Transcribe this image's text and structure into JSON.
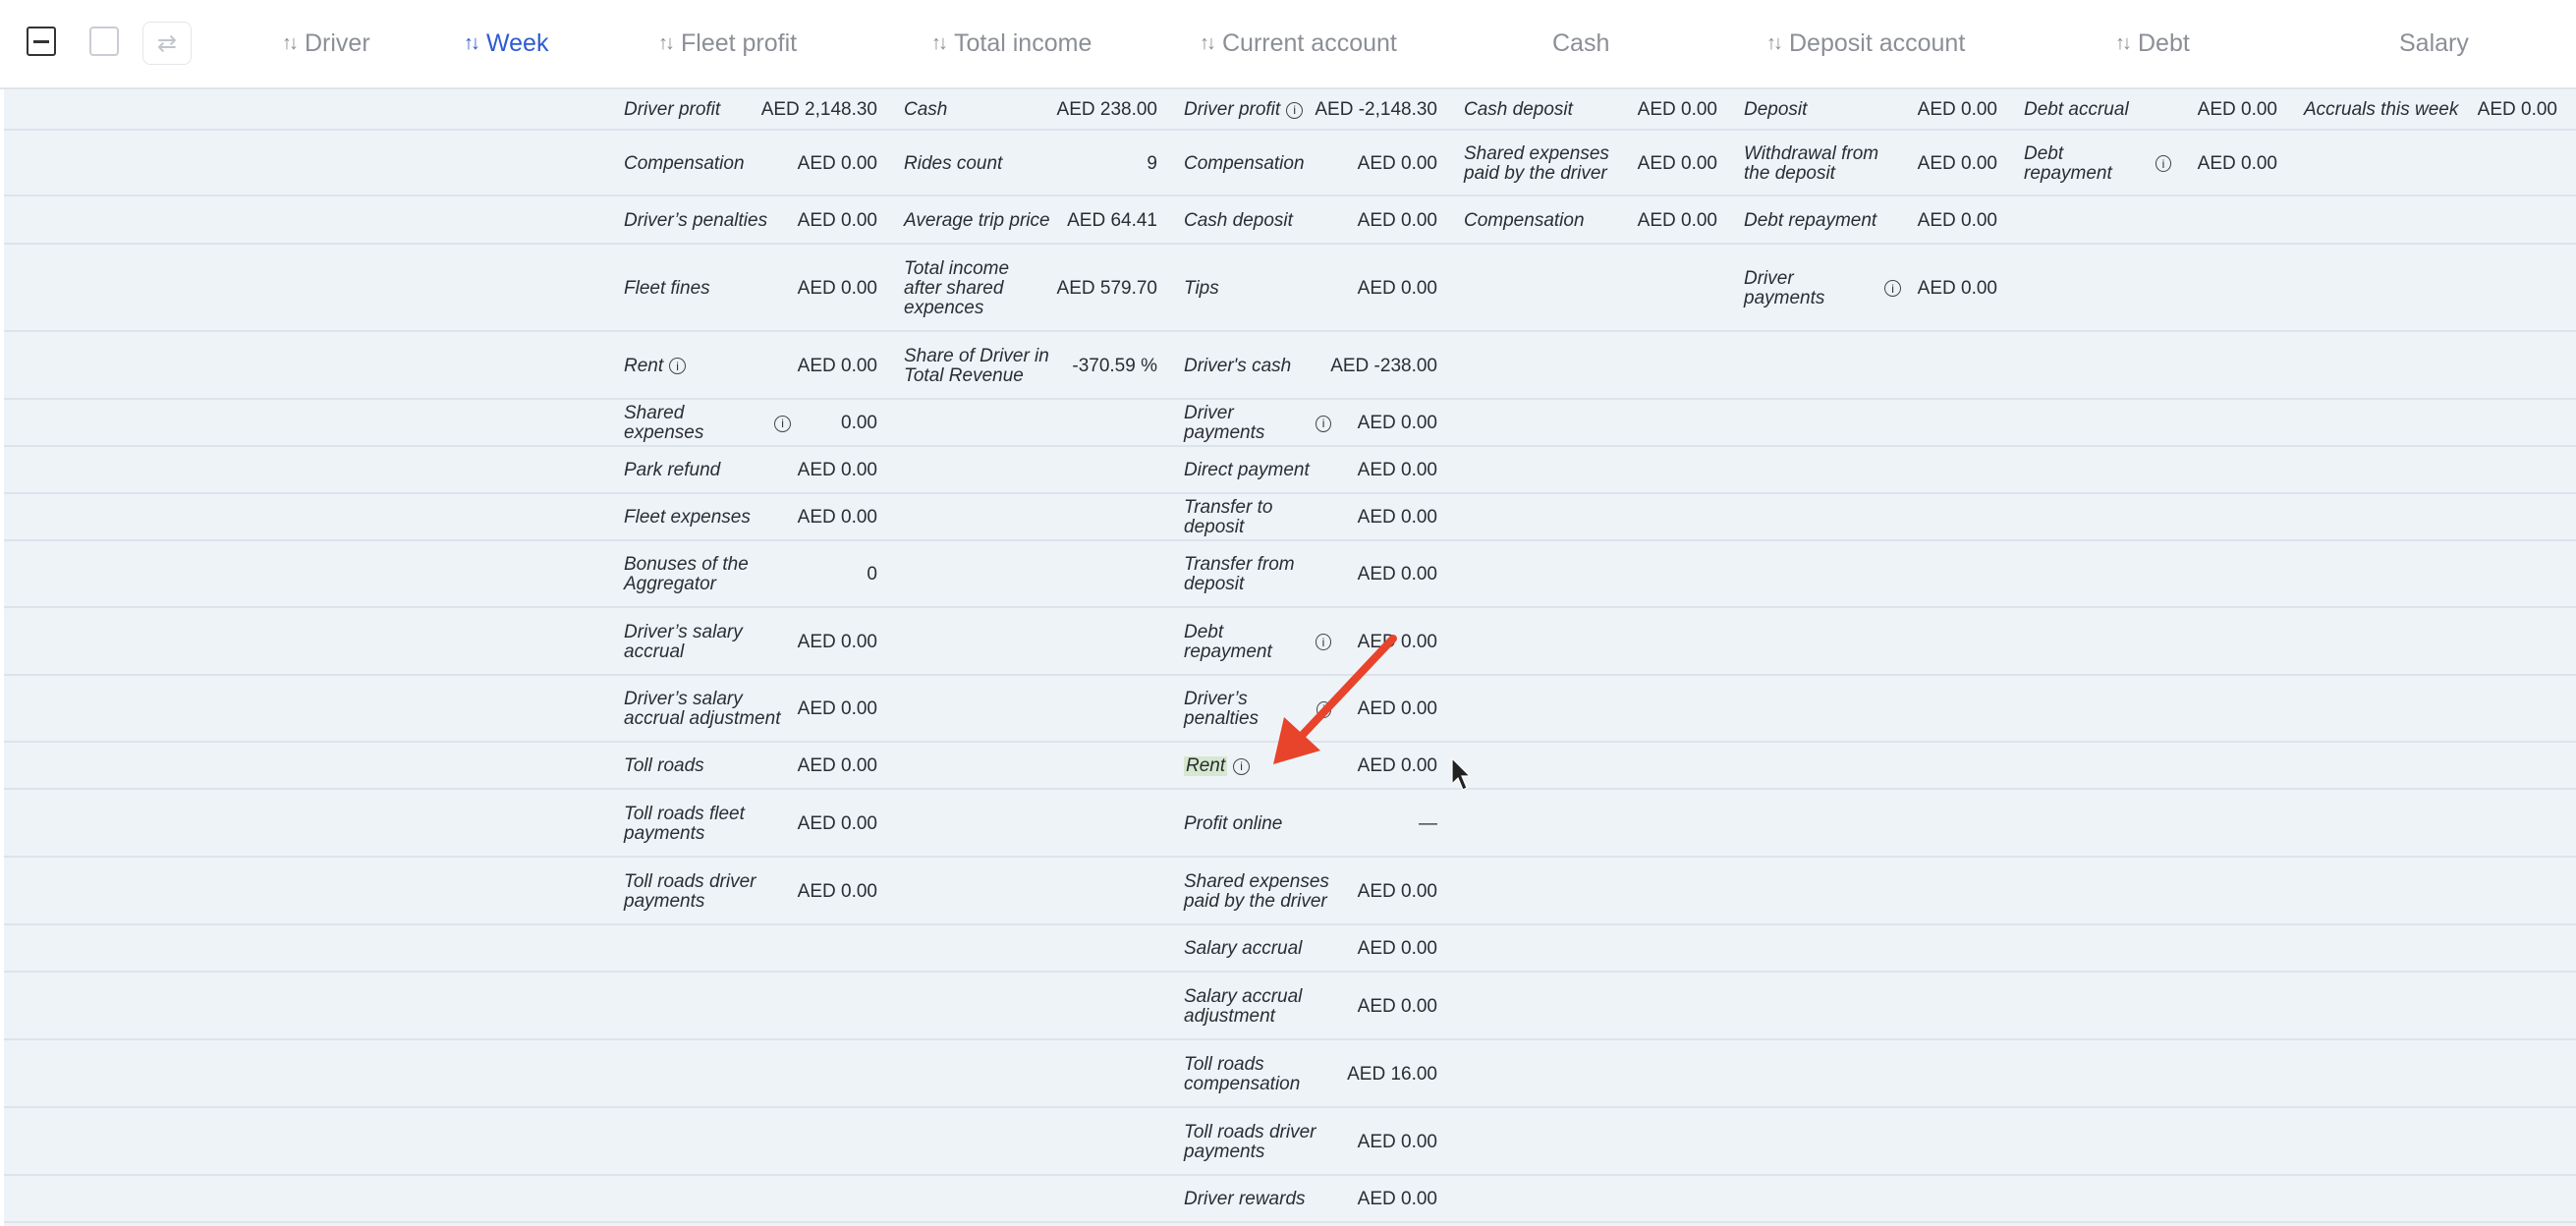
{
  "header": {
    "columns": [
      {
        "label": "Driver",
        "sortable": true,
        "active": false
      },
      {
        "label": "Week",
        "sortable": true,
        "active": true
      },
      {
        "label": "Fleet profit",
        "sortable": true,
        "active": false
      },
      {
        "label": "Total income",
        "sortable": true,
        "active": false
      },
      {
        "label": "Current account",
        "sortable": true,
        "active": false
      },
      {
        "label": "Cash",
        "sortable": false,
        "active": false
      },
      {
        "label": "Deposit account",
        "sortable": true,
        "active": false
      },
      {
        "label": "Debt",
        "sortable": true,
        "active": false
      },
      {
        "label": "Salary",
        "sortable": false,
        "active": false
      }
    ]
  },
  "columns": {
    "fleet_profit": [
      {
        "label": "Driver profit",
        "value": "AED 2,148.30"
      },
      {
        "label": "Compensation",
        "value": "AED 0.00"
      },
      {
        "label": "Driver’s penalties",
        "value": "AED 0.00"
      },
      {
        "label": "Fleet fines",
        "value": "AED 0.00"
      },
      {
        "label": "Rent",
        "value": "AED 0.00",
        "info": true
      },
      {
        "label": "Shared expenses",
        "value": "0.00",
        "info": true
      },
      {
        "label": "Park refund",
        "value": "AED 0.00"
      },
      {
        "label": "Fleet expenses",
        "value": "AED 0.00"
      },
      {
        "label": "Bonuses of the Aggregator",
        "value": "0"
      },
      {
        "label": "Driver’s salary accrual",
        "value": "AED 0.00"
      },
      {
        "label": "Driver’s salary accrual adjustment",
        "value": "AED 0.00"
      },
      {
        "label": "Toll roads",
        "value": "AED 0.00"
      },
      {
        "label": "Toll roads fleet payments",
        "value": "AED 0.00"
      },
      {
        "label": "Toll roads driver payments",
        "value": "AED 0.00"
      }
    ],
    "total_income": [
      {
        "label": "Cash",
        "value": "AED 238.00"
      },
      {
        "label": "Rides count",
        "value": "9"
      },
      {
        "label": "Average trip price",
        "value": "AED 64.41"
      },
      {
        "label": "Total income after shared expences",
        "value": "AED 579.70"
      },
      {
        "label": "Share of Driver in Total Revenue",
        "value": "-370.59 %"
      }
    ],
    "current_account": [
      {
        "label": "Driver profit",
        "value": "AED -2,148.30",
        "info": true
      },
      {
        "label": "Compensation",
        "value": "AED 0.00"
      },
      {
        "label": "Cash deposit",
        "value": "AED 0.00"
      },
      {
        "label": "Tips",
        "value": "AED 0.00"
      },
      {
        "label": "Driver's cash",
        "value": "AED -238.00"
      },
      {
        "label": "Driver payments",
        "value": "AED 0.00",
        "info": true
      },
      {
        "label": "Direct payment",
        "value": "AED 0.00"
      },
      {
        "label": "Transfer to deposit",
        "value": "AED 0.00"
      },
      {
        "label": "Transfer from deposit",
        "value": "AED 0.00"
      },
      {
        "label": "Debt repayment",
        "value": "AED 0.00",
        "info": true
      },
      {
        "label": "Driver’s penalties",
        "value": "AED 0.00",
        "info": true
      },
      {
        "label": "Rent",
        "value": "AED 0.00",
        "info": true,
        "highlight": true
      },
      {
        "label": "Profit online",
        "value": "—"
      },
      {
        "label": "Shared expenses paid by the driver",
        "value": "AED 0.00"
      },
      {
        "label": "Salary accrual",
        "value": "AED 0.00"
      },
      {
        "label": "Salary accrual adjustment",
        "value": "AED 0.00"
      },
      {
        "label": "Toll roads compensation",
        "value": "AED 16.00"
      },
      {
        "label": "Toll roads driver payments",
        "value": "AED 0.00"
      },
      {
        "label": "Driver rewards",
        "value": "AED 0.00"
      }
    ],
    "cash": [
      {
        "label": "Cash deposit",
        "value": "AED 0.00"
      },
      {
        "label": "Shared expenses paid by the driver",
        "value": "AED 0.00"
      },
      {
        "label": "Compensation",
        "value": "AED 0.00"
      }
    ],
    "deposit_account": [
      {
        "label": "Deposit",
        "value": "AED 0.00"
      },
      {
        "label": "Withdrawal from the deposit",
        "value": "AED 0.00"
      },
      {
        "label": "Debt repayment",
        "value": "AED 0.00"
      },
      {
        "label": "Driver payments",
        "value": "AED 0.00",
        "info": true
      }
    ],
    "debt": [
      {
        "label": "Debt accrual",
        "value": "AED 0.00"
      },
      {
        "label": "Debt repayment",
        "value": "AED 0.00",
        "info": true
      }
    ],
    "salary": [
      {
        "label": "Accruals this week",
        "value": "AED 0.00"
      }
    ]
  },
  "colors": {
    "accent": "#2f5bd3",
    "annotation_arrow": "#e8432b",
    "highlight": "#d6e8cf",
    "row_bg": "#eef3f8"
  }
}
